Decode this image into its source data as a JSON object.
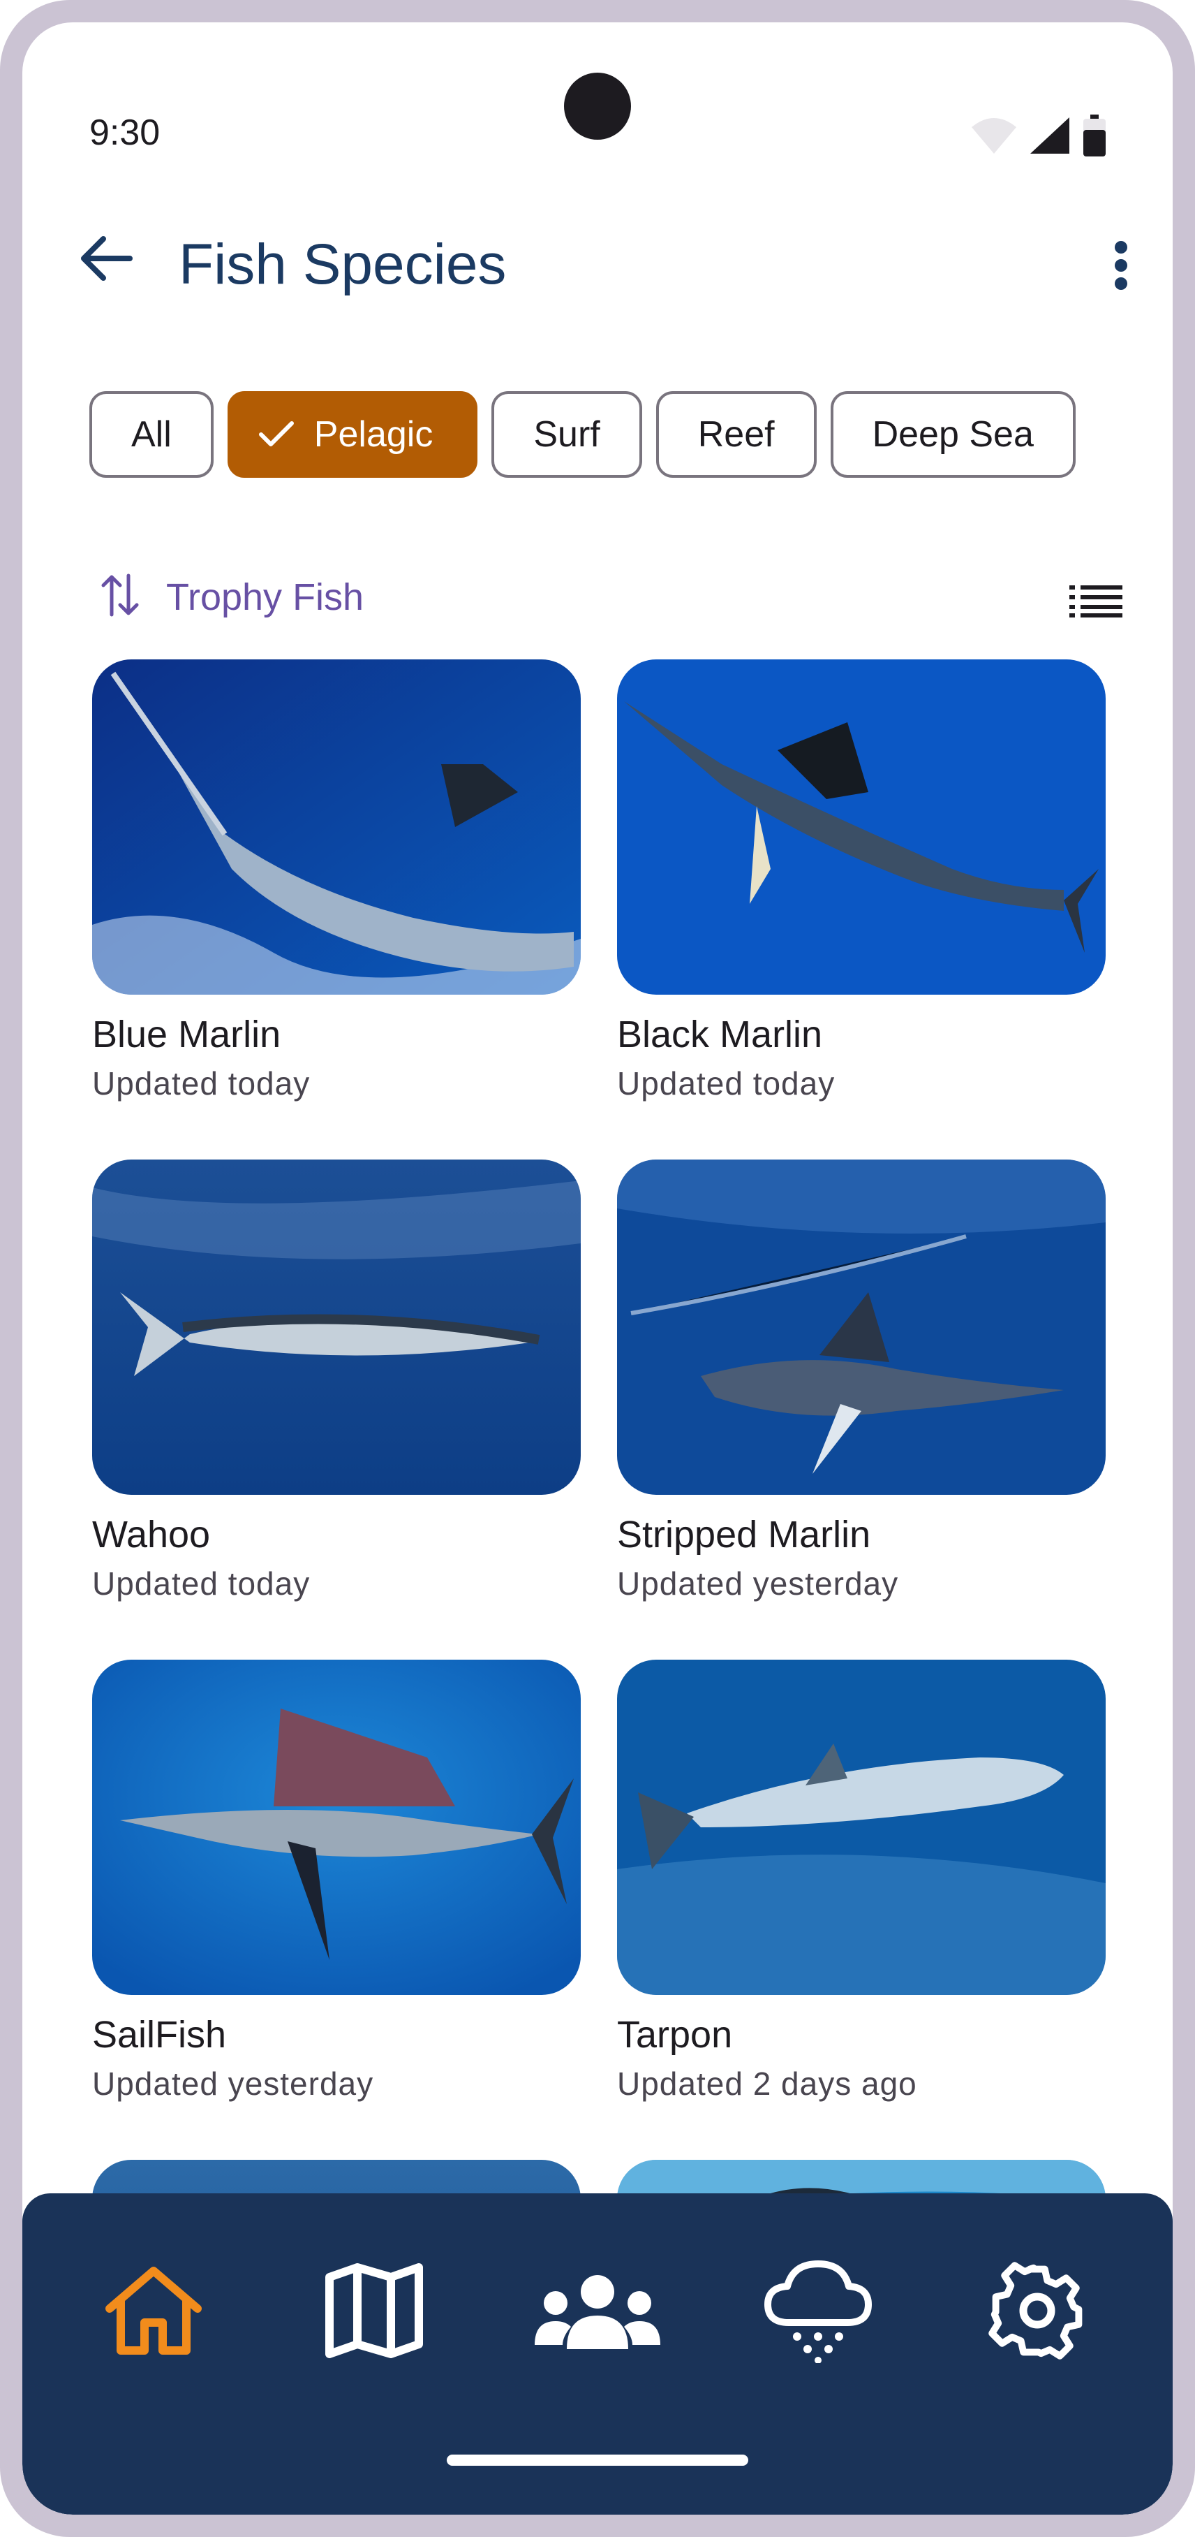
{
  "status_bar": {
    "time": "9:30"
  },
  "app_bar": {
    "title": "Fish Species"
  },
  "filters": [
    {
      "label": "All",
      "selected": false
    },
    {
      "label": "Pelagic",
      "selected": true
    },
    {
      "label": "Surf",
      "selected": false
    },
    {
      "label": "Reef",
      "selected": false
    },
    {
      "label": "Deep Sea",
      "selected": false
    }
  ],
  "sort": {
    "label": "Trophy Fish"
  },
  "species": [
    {
      "name": "Blue Marlin",
      "updated": "Updated today"
    },
    {
      "name": "Black Marlin",
      "updated": "Updated today"
    },
    {
      "name": "Wahoo",
      "updated": "Updated today"
    },
    {
      "name": "Stripped Marlin",
      "updated": "Updated yesterday"
    },
    {
      "name": "SailFish",
      "updated": "Updated yesterday"
    },
    {
      "name": "Tarpon",
      "updated": "Updated 2 days ago"
    }
  ],
  "bottom_nav": [
    {
      "icon": "home-icon",
      "active": true
    },
    {
      "icon": "map-icon",
      "active": false
    },
    {
      "icon": "community-icon",
      "active": false
    },
    {
      "icon": "weather-icon",
      "active": false
    },
    {
      "icon": "settings-icon",
      "active": false
    }
  ],
  "colors": {
    "primary": "#1b3a62",
    "accent": "#b25c04",
    "nav_active": "#f28c1c",
    "nav_background": "#1a3358",
    "sort_label": "#6750a4"
  }
}
